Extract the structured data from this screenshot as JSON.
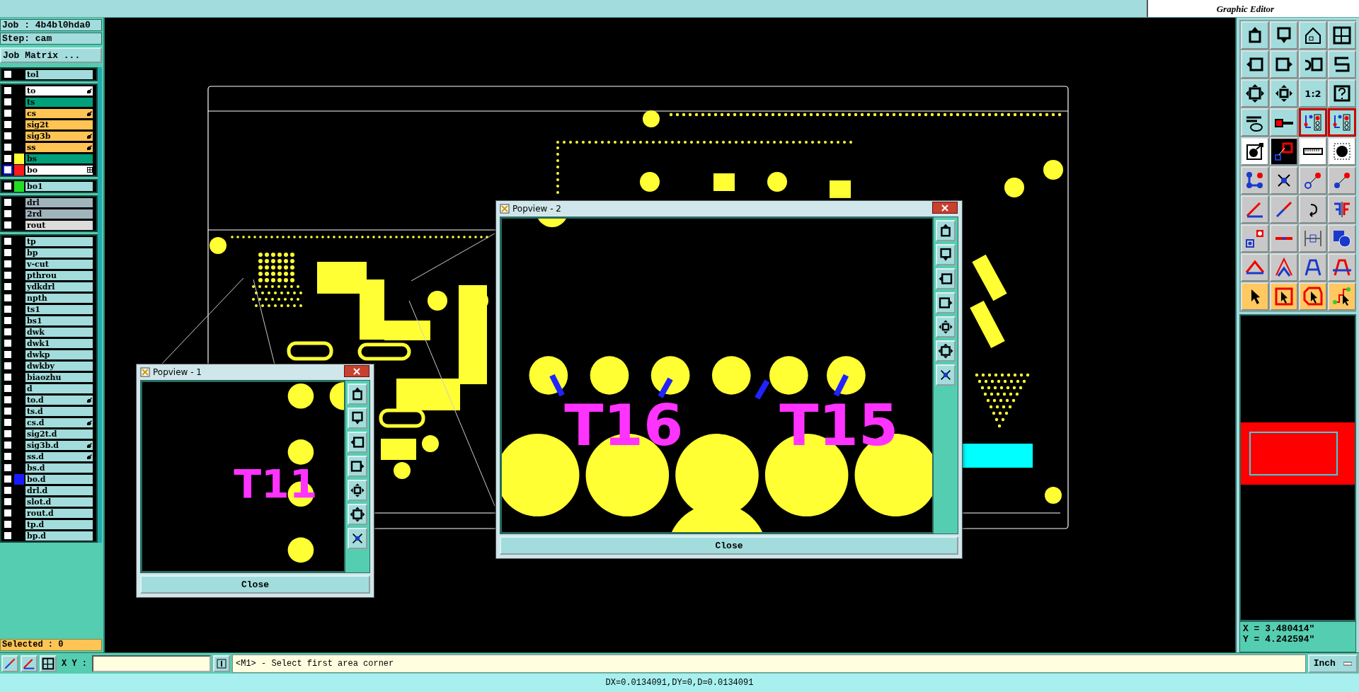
{
  "job": {
    "name": "Job : 4b4bl0hda0",
    "step": "Step: cam",
    "matrix_button": "Job Matrix ..."
  },
  "layer_groups": [
    [
      {
        "name": "tol",
        "kind": "misc",
        "checked": false,
        "affected": false,
        "work": false
      }
    ],
    [
      {
        "name": "to",
        "kind": "silk",
        "checked": false,
        "affected": true,
        "work": false
      },
      {
        "name": "ts",
        "kind": "mask",
        "checked": false,
        "affected": false,
        "work": false
      },
      {
        "name": "cs",
        "kind": "signal",
        "checked": false,
        "affected": true,
        "work": false
      },
      {
        "name": "sig2t",
        "kind": "signal",
        "checked": false,
        "affected": false,
        "work": false
      },
      {
        "name": "sig3b",
        "kind": "signal",
        "checked": false,
        "affected": true,
        "work": false
      },
      {
        "name": "ss",
        "kind": "signal",
        "checked": false,
        "affected": true,
        "work": false
      },
      {
        "name": "bs",
        "kind": "mask",
        "checked": false,
        "affected": false,
        "work": false,
        "color": "#ffff33"
      },
      {
        "name": "bo",
        "kind": "silk",
        "checked": false,
        "affected": false,
        "work": true,
        "color": "#ff1a1a"
      }
    ],
    [
      {
        "name": "bo1",
        "kind": "misc",
        "checked": false,
        "affected": false,
        "work": false,
        "color": "#22dd22"
      }
    ],
    [
      {
        "name": "drl",
        "kind": "drill",
        "checked": false,
        "affected": false,
        "work": false
      },
      {
        "name": "2rd",
        "kind": "drill",
        "checked": false,
        "affected": false,
        "work": false
      },
      {
        "name": "rout",
        "kind": "rout",
        "checked": false,
        "affected": false,
        "work": false
      }
    ],
    [
      {
        "name": "tp",
        "kind": "misc",
        "checked": false,
        "affected": false,
        "work": false
      },
      {
        "name": "bp",
        "kind": "misc",
        "checked": false,
        "affected": false,
        "work": false
      },
      {
        "name": "v-cut",
        "kind": "misc",
        "checked": false,
        "affected": false,
        "work": false
      },
      {
        "name": "pthrou",
        "kind": "misc",
        "checked": false,
        "affected": false,
        "work": false
      },
      {
        "name": "ydkdrl",
        "kind": "misc",
        "checked": false,
        "affected": false,
        "work": false
      },
      {
        "name": "npth",
        "kind": "misc",
        "checked": false,
        "affected": false,
        "work": false
      },
      {
        "name": "ts1",
        "kind": "misc",
        "checked": false,
        "affected": false,
        "work": false
      },
      {
        "name": "bs1",
        "kind": "misc",
        "checked": false,
        "affected": false,
        "work": false
      },
      {
        "name": "dwk",
        "kind": "misc",
        "checked": false,
        "affected": false,
        "work": false
      },
      {
        "name": "dwk1",
        "kind": "misc",
        "checked": false,
        "affected": false,
        "work": false
      },
      {
        "name": "dwkp",
        "kind": "misc",
        "checked": false,
        "affected": false,
        "work": false
      },
      {
        "name": "dwkby",
        "kind": "misc",
        "checked": false,
        "affected": false,
        "work": false
      },
      {
        "name": "biaozhu",
        "kind": "misc",
        "checked": false,
        "affected": false,
        "work": false
      },
      {
        "name": "d",
        "kind": "misc",
        "checked": false,
        "affected": false,
        "work": false
      },
      {
        "name": "to.d",
        "kind": "misc",
        "checked": false,
        "affected": true,
        "work": false
      },
      {
        "name": "ts.d",
        "kind": "misc",
        "checked": false,
        "affected": false,
        "work": false
      },
      {
        "name": "cs.d",
        "kind": "misc",
        "checked": false,
        "affected": true,
        "work": false
      },
      {
        "name": "sig2t.d",
        "kind": "misc",
        "checked": false,
        "affected": false,
        "work": false
      },
      {
        "name": "sig3b.d",
        "kind": "misc",
        "checked": false,
        "affected": true,
        "work": false
      },
      {
        "name": "ss.d",
        "kind": "misc",
        "checked": false,
        "affected": true,
        "work": false
      },
      {
        "name": "bs.d",
        "kind": "misc",
        "checked": false,
        "affected": false,
        "work": false
      },
      {
        "name": "bo.d",
        "kind": "misc",
        "checked": false,
        "affected": false,
        "work": false,
        "color": "#1a1aff"
      },
      {
        "name": "drl.d",
        "kind": "misc",
        "checked": false,
        "affected": false,
        "work": false
      },
      {
        "name": "slot.d",
        "kind": "misc",
        "checked": false,
        "affected": false,
        "work": false
      },
      {
        "name": "rout.d",
        "kind": "misc",
        "checked": false,
        "affected": false,
        "work": false
      },
      {
        "name": "tp.d",
        "kind": "misc",
        "checked": false,
        "affected": false,
        "work": false
      },
      {
        "name": "bp.d",
        "kind": "misc",
        "checked": false,
        "affected": false,
        "work": false
      }
    ]
  ],
  "selected": "Selected : 0",
  "title": {
    "subtitle": "Graphic Editor"
  },
  "popviews": [
    {
      "title": "Popview - 1",
      "labels": [
        "T11"
      ],
      "close": "Close"
    },
    {
      "title": "Popview - 2",
      "labels": [
        "T16",
        "T15"
      ],
      "close": "Close"
    }
  ],
  "toolbox": {
    "scale_label": "1:2"
  },
  "coords": {
    "x": "X = 3.480414\"",
    "y": "Y = 4.242594\""
  },
  "command": {
    "xy_label": "X Y :",
    "message": "<M1> - Select first area corner",
    "units": "Inch"
  },
  "status": "DX=0.0134091,DY=0,D=0.0134091"
}
